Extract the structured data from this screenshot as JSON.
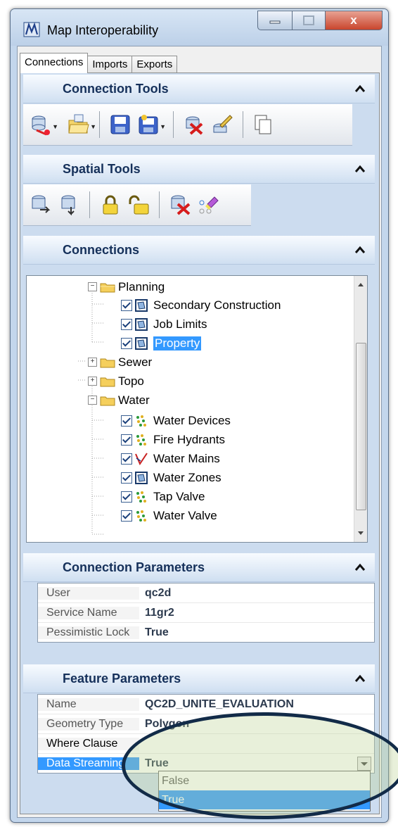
{
  "window": {
    "title": "Map Interoperability",
    "close_glyph": "x"
  },
  "tabs": [
    "Connections",
    "Imports",
    "Exports"
  ],
  "sections": {
    "connection_tools": "Connection Tools",
    "spatial_tools": "Spatial Tools",
    "connections": "Connections",
    "connection_parameters": "Connection Parameters",
    "feature_parameters": "Feature Parameters"
  },
  "tree": {
    "planning": "Planning",
    "planning_children": [
      "Secondary Construction",
      "Job Limits",
      "Property"
    ],
    "sewer": "Sewer",
    "topo": "Topo",
    "water": "Water",
    "water_children": [
      "Water Devices",
      "Fire Hydrants",
      "Water Mains",
      "Water Zones",
      "Tap Valve",
      "Water Valve"
    ]
  },
  "connection_parameters": [
    {
      "name": "User",
      "value": "qc2d"
    },
    {
      "name": "Service Name",
      "value": "11gr2"
    },
    {
      "name": "Pessimistic Lock",
      "value": "True"
    }
  ],
  "feature_parameters": [
    {
      "name": "Name",
      "value": "QC2D_UNITE_EVALUATION"
    },
    {
      "name": "Geometry Type",
      "value": "Polygon"
    },
    {
      "name": "Where Clause",
      "value": ""
    },
    {
      "name": "Data Streaming",
      "value": "True"
    }
  ],
  "dropdown_options": [
    "False",
    "True"
  ],
  "colors": {
    "selection": "#3399ff",
    "header_text": "#15305a",
    "highlight_ellipse": "#122b48"
  }
}
